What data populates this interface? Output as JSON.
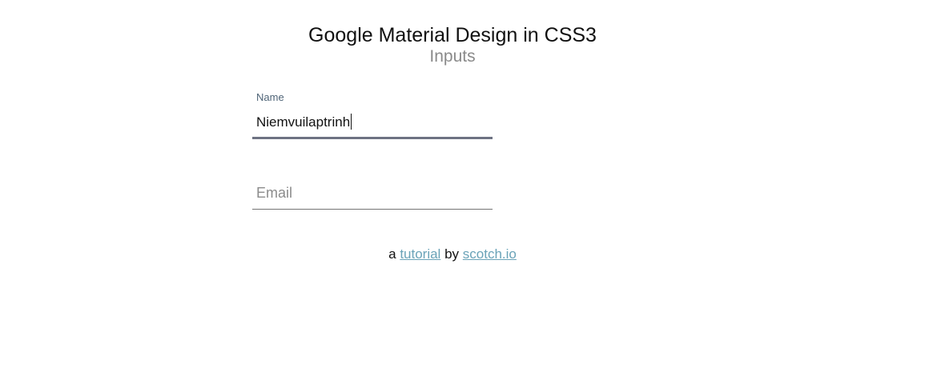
{
  "header": {
    "title": "Google Material Design in CSS3",
    "subtitle": "Inputs"
  },
  "form": {
    "name_field": {
      "label": "Name",
      "value": "Niemvuilaptrinh"
    },
    "email_field": {
      "label": "Email",
      "value": ""
    }
  },
  "footer": {
    "prefix": "a",
    "tutorial_link": "tutorial",
    "by": "by",
    "site_link": "scotch.io"
  },
  "colors": {
    "accent_link": "#6aa3b8",
    "focused_underline": "#6e7283",
    "label": "#4f6477"
  }
}
